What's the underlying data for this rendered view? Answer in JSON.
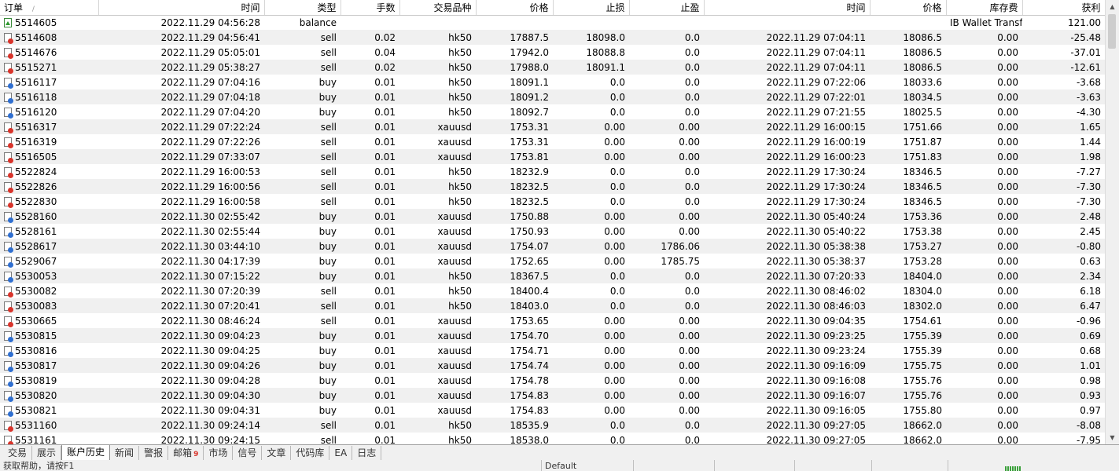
{
  "columns": [
    "订单",
    "时间",
    "类型",
    "手数",
    "交易品种",
    "价格",
    "止损",
    "止盈",
    "时间",
    "价格",
    "库存费",
    "获利"
  ],
  "sort_indicator": "/",
  "rows": [
    {
      "order": "5514605",
      "open_time": "2022.11.29 04:56:28",
      "type": "balance",
      "lots": "",
      "symbol": "",
      "open_price": "",
      "sl": "",
      "tp": "",
      "close_time": "",
      "close_price": "",
      "swap": "IB Wallet Transfer",
      "profit": "121.00"
    },
    {
      "order": "5514608",
      "open_time": "2022.11.29 04:56:41",
      "type": "sell",
      "lots": "0.02",
      "symbol": "hk50",
      "open_price": "17887.5",
      "sl": "18098.0",
      "tp": "0.0",
      "close_time": "2022.11.29 07:04:11",
      "close_price": "18086.5",
      "swap": "0.00",
      "profit": "-25.48"
    },
    {
      "order": "5514676",
      "open_time": "2022.11.29 05:05:01",
      "type": "sell",
      "lots": "0.04",
      "symbol": "hk50",
      "open_price": "17942.0",
      "sl": "18088.8",
      "tp": "0.0",
      "close_time": "2022.11.29 07:04:11",
      "close_price": "18086.5",
      "swap": "0.00",
      "profit": "-37.01"
    },
    {
      "order": "5515271",
      "open_time": "2022.11.29 05:38:27",
      "type": "sell",
      "lots": "0.02",
      "symbol": "hk50",
      "open_price": "17988.0",
      "sl": "18091.1",
      "tp": "0.0",
      "close_time": "2022.11.29 07:04:11",
      "close_price": "18086.5",
      "swap": "0.00",
      "profit": "-12.61"
    },
    {
      "order": "5516117",
      "open_time": "2022.11.29 07:04:16",
      "type": "buy",
      "lots": "0.01",
      "symbol": "hk50",
      "open_price": "18091.1",
      "sl": "0.0",
      "tp": "0.0",
      "close_time": "2022.11.29 07:22:06",
      "close_price": "18033.6",
      "swap": "0.00",
      "profit": "-3.68"
    },
    {
      "order": "5516118",
      "open_time": "2022.11.29 07:04:18",
      "type": "buy",
      "lots": "0.01",
      "symbol": "hk50",
      "open_price": "18091.2",
      "sl": "0.0",
      "tp": "0.0",
      "close_time": "2022.11.29 07:22:01",
      "close_price": "18034.5",
      "swap": "0.00",
      "profit": "-3.63"
    },
    {
      "order": "5516120",
      "open_time": "2022.11.29 07:04:20",
      "type": "buy",
      "lots": "0.01",
      "symbol": "hk50",
      "open_price": "18092.7",
      "sl": "0.0",
      "tp": "0.0",
      "close_time": "2022.11.29 07:21:55",
      "close_price": "18025.5",
      "swap": "0.00",
      "profit": "-4.30"
    },
    {
      "order": "5516317",
      "open_time": "2022.11.29 07:22:24",
      "type": "sell",
      "lots": "0.01",
      "symbol": "xauusd",
      "open_price": "1753.31",
      "sl": "0.00",
      "tp": "0.00",
      "close_time": "2022.11.29 16:00:15",
      "close_price": "1751.66",
      "swap": "0.00",
      "profit": "1.65"
    },
    {
      "order": "5516319",
      "open_time": "2022.11.29 07:22:26",
      "type": "sell",
      "lots": "0.01",
      "symbol": "xauusd",
      "open_price": "1753.31",
      "sl": "0.00",
      "tp": "0.00",
      "close_time": "2022.11.29 16:00:19",
      "close_price": "1751.87",
      "swap": "0.00",
      "profit": "1.44"
    },
    {
      "order": "5516505",
      "open_time": "2022.11.29 07:33:07",
      "type": "sell",
      "lots": "0.01",
      "symbol": "xauusd",
      "open_price": "1753.81",
      "sl": "0.00",
      "tp": "0.00",
      "close_time": "2022.11.29 16:00:23",
      "close_price": "1751.83",
      "swap": "0.00",
      "profit": "1.98"
    },
    {
      "order": "5522824",
      "open_time": "2022.11.29 16:00:53",
      "type": "sell",
      "lots": "0.01",
      "symbol": "hk50",
      "open_price": "18232.9",
      "sl": "0.0",
      "tp": "0.0",
      "close_time": "2022.11.29 17:30:24",
      "close_price": "18346.5",
      "swap": "0.00",
      "profit": "-7.27"
    },
    {
      "order": "5522826",
      "open_time": "2022.11.29 16:00:56",
      "type": "sell",
      "lots": "0.01",
      "symbol": "hk50",
      "open_price": "18232.5",
      "sl": "0.0",
      "tp": "0.0",
      "close_time": "2022.11.29 17:30:24",
      "close_price": "18346.5",
      "swap": "0.00",
      "profit": "-7.30"
    },
    {
      "order": "5522830",
      "open_time": "2022.11.29 16:00:58",
      "type": "sell",
      "lots": "0.01",
      "symbol": "hk50",
      "open_price": "18232.5",
      "sl": "0.0",
      "tp": "0.0",
      "close_time": "2022.11.29 17:30:24",
      "close_price": "18346.5",
      "swap": "0.00",
      "profit": "-7.30"
    },
    {
      "order": "5528160",
      "open_time": "2022.11.30 02:55:42",
      "type": "buy",
      "lots": "0.01",
      "symbol": "xauusd",
      "open_price": "1750.88",
      "sl": "0.00",
      "tp": "0.00",
      "close_time": "2022.11.30 05:40:24",
      "close_price": "1753.36",
      "swap": "0.00",
      "profit": "2.48"
    },
    {
      "order": "5528161",
      "open_time": "2022.11.30 02:55:44",
      "type": "buy",
      "lots": "0.01",
      "symbol": "xauusd",
      "open_price": "1750.93",
      "sl": "0.00",
      "tp": "0.00",
      "close_time": "2022.11.30 05:40:22",
      "close_price": "1753.38",
      "swap": "0.00",
      "profit": "2.45"
    },
    {
      "order": "5528617",
      "open_time": "2022.11.30 03:44:10",
      "type": "buy",
      "lots": "0.01",
      "symbol": "xauusd",
      "open_price": "1754.07",
      "sl": "0.00",
      "tp": "1786.06",
      "close_time": "2022.11.30 05:38:38",
      "close_price": "1753.27",
      "swap": "0.00",
      "profit": "-0.80"
    },
    {
      "order": "5529067",
      "open_time": "2022.11.30 04:17:39",
      "type": "buy",
      "lots": "0.01",
      "symbol": "xauusd",
      "open_price": "1752.65",
      "sl": "0.00",
      "tp": "1785.75",
      "close_time": "2022.11.30 05:38:37",
      "close_price": "1753.28",
      "swap": "0.00",
      "profit": "0.63"
    },
    {
      "order": "5530053",
      "open_time": "2022.11.30 07:15:22",
      "type": "buy",
      "lots": "0.01",
      "symbol": "hk50",
      "open_price": "18367.5",
      "sl": "0.0",
      "tp": "0.0",
      "close_time": "2022.11.30 07:20:33",
      "close_price": "18404.0",
      "swap": "0.00",
      "profit": "2.34"
    },
    {
      "order": "5530082",
      "open_time": "2022.11.30 07:20:39",
      "type": "sell",
      "lots": "0.01",
      "symbol": "hk50",
      "open_price": "18400.4",
      "sl": "0.0",
      "tp": "0.0",
      "close_time": "2022.11.30 08:46:02",
      "close_price": "18304.0",
      "swap": "0.00",
      "profit": "6.18"
    },
    {
      "order": "5530083",
      "open_time": "2022.11.30 07:20:41",
      "type": "sell",
      "lots": "0.01",
      "symbol": "hk50",
      "open_price": "18403.0",
      "sl": "0.0",
      "tp": "0.0",
      "close_time": "2022.11.30 08:46:03",
      "close_price": "18302.0",
      "swap": "0.00",
      "profit": "6.47"
    },
    {
      "order": "5530665",
      "open_time": "2022.11.30 08:46:24",
      "type": "sell",
      "lots": "0.01",
      "symbol": "xauusd",
      "open_price": "1753.65",
      "sl": "0.00",
      "tp": "0.00",
      "close_time": "2022.11.30 09:04:35",
      "close_price": "1754.61",
      "swap": "0.00",
      "profit": "-0.96"
    },
    {
      "order": "5530815",
      "open_time": "2022.11.30 09:04:23",
      "type": "buy",
      "lots": "0.01",
      "symbol": "xauusd",
      "open_price": "1754.70",
      "sl": "0.00",
      "tp": "0.00",
      "close_time": "2022.11.30 09:23:25",
      "close_price": "1755.39",
      "swap": "0.00",
      "profit": "0.69"
    },
    {
      "order": "5530816",
      "open_time": "2022.11.30 09:04:25",
      "type": "buy",
      "lots": "0.01",
      "symbol": "xauusd",
      "open_price": "1754.71",
      "sl": "0.00",
      "tp": "0.00",
      "close_time": "2022.11.30 09:23:24",
      "close_price": "1755.39",
      "swap": "0.00",
      "profit": "0.68"
    },
    {
      "order": "5530817",
      "open_time": "2022.11.30 09:04:26",
      "type": "buy",
      "lots": "0.01",
      "symbol": "xauusd",
      "open_price": "1754.74",
      "sl": "0.00",
      "tp": "0.00",
      "close_time": "2022.11.30 09:16:09",
      "close_price": "1755.75",
      "swap": "0.00",
      "profit": "1.01"
    },
    {
      "order": "5530819",
      "open_time": "2022.11.30 09:04:28",
      "type": "buy",
      "lots": "0.01",
      "symbol": "xauusd",
      "open_price": "1754.78",
      "sl": "0.00",
      "tp": "0.00",
      "close_time": "2022.11.30 09:16:08",
      "close_price": "1755.76",
      "swap": "0.00",
      "profit": "0.98"
    },
    {
      "order": "5530820",
      "open_time": "2022.11.30 09:04:30",
      "type": "buy",
      "lots": "0.01",
      "symbol": "xauusd",
      "open_price": "1754.83",
      "sl": "0.00",
      "tp": "0.00",
      "close_time": "2022.11.30 09:16:07",
      "close_price": "1755.76",
      "swap": "0.00",
      "profit": "0.93"
    },
    {
      "order": "5530821",
      "open_time": "2022.11.30 09:04:31",
      "type": "buy",
      "lots": "0.01",
      "symbol": "xauusd",
      "open_price": "1754.83",
      "sl": "0.00",
      "tp": "0.00",
      "close_time": "2022.11.30 09:16:05",
      "close_price": "1755.80",
      "swap": "0.00",
      "profit": "0.97"
    },
    {
      "order": "5531160",
      "open_time": "2022.11.30 09:24:14",
      "type": "sell",
      "lots": "0.01",
      "symbol": "hk50",
      "open_price": "18535.9",
      "sl": "0.0",
      "tp": "0.0",
      "close_time": "2022.11.30 09:27:05",
      "close_price": "18662.0",
      "swap": "0.00",
      "profit": "-8.08"
    },
    {
      "order": "5531161",
      "open_time": "2022.11.30 09:24:15",
      "type": "sell",
      "lots": "0.01",
      "symbol": "hk50",
      "open_price": "18538.0",
      "sl": "0.0",
      "tp": "0.0",
      "close_time": "2022.11.30 09:27:05",
      "close_price": "18662.0",
      "swap": "0.00",
      "profit": "-7.95"
    }
  ],
  "tabs": [
    {
      "label": "交易",
      "active": false
    },
    {
      "label": "展示",
      "active": false
    },
    {
      "label": "账户历史",
      "active": true
    },
    {
      "label": "新闻",
      "active": false
    },
    {
      "label": "警报",
      "active": false
    },
    {
      "label": "邮箱",
      "active": false,
      "badge": "9"
    },
    {
      "label": "市场",
      "active": false
    },
    {
      "label": "信号",
      "active": false
    },
    {
      "label": "文章",
      "active": false
    },
    {
      "label": "代码库",
      "active": false
    },
    {
      "label": "EA",
      "active": false
    },
    {
      "label": "日志",
      "active": false
    }
  ],
  "status": {
    "left": "获取帮助，请按F1",
    "middle": "Default"
  },
  "colors": {
    "sell_icon": "#d9342b",
    "buy_icon": "#2f6fd1",
    "balance_icon": "#2e9a2e",
    "row_alt": "#f0f0f0"
  }
}
